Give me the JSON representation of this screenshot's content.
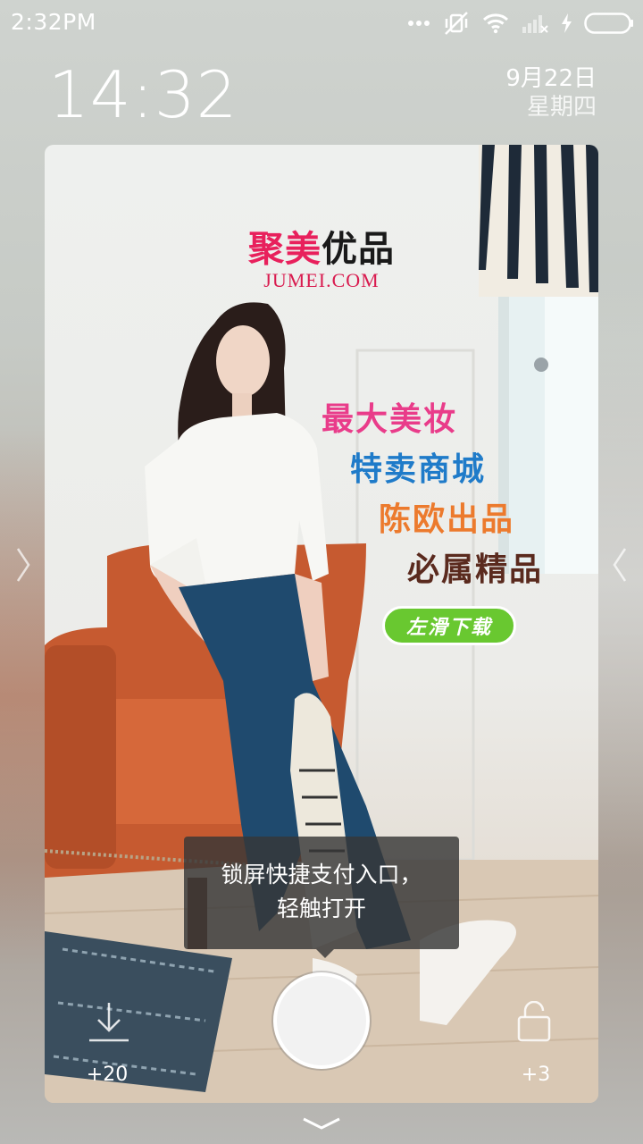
{
  "status_bar": {
    "time": "2:32PM",
    "icons": [
      "more-dots-icon",
      "mute-vibrate-off-icon",
      "wifi-icon",
      "signal-no-sim-icon",
      "charging-icon",
      "battery-icon"
    ]
  },
  "lockscreen": {
    "clock": "14:32",
    "date": "9月22日",
    "weekday": "星期四"
  },
  "ad": {
    "brand_cn_part1": "聚美",
    "brand_cn_part2": "优品",
    "brand_en": "JUMEI.COM",
    "slogans": [
      "最大美妆",
      "特卖商城",
      "陈欧出品",
      "必属精品"
    ],
    "download_button": "左滑下载",
    "colors": {
      "pink": "#e93c8a",
      "blue": "#1f7bc9",
      "orange": "#ec7a2d",
      "brown": "#5a2a1e",
      "green": "#69c830"
    }
  },
  "tooltip": {
    "line1": "锁屏快捷支付入口，",
    "line2": "轻触打开"
  },
  "bottom": {
    "download_count": "+20",
    "unlock_count": "+3"
  }
}
